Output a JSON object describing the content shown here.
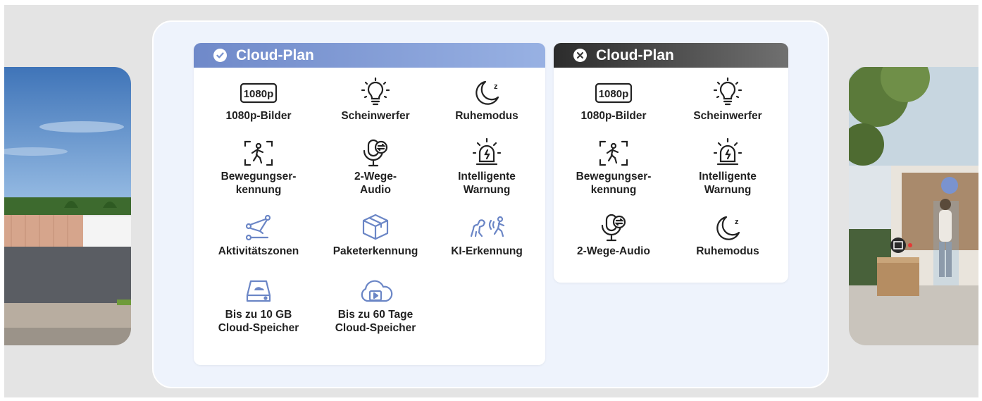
{
  "colors": {
    "background": "#e4e4e4",
    "panel": "#eef3fc",
    "premium_header": "#7a93cf",
    "basic_header": "#3a3a3a",
    "premium_feature_text": "#6b86c6",
    "feature_text": "#222222"
  },
  "premium": {
    "header_icon": "check-circle-icon",
    "title": "Cloud-Plan",
    "features": [
      {
        "label": "1080p-Bilder",
        "icon": "1080p-icon",
        "badge": "1080p"
      },
      {
        "label": "Scheinwerfer",
        "icon": "lightbulb-icon"
      },
      {
        "label": "Ruhemodus",
        "icon": "moon-icon",
        "badge": "z"
      },
      {
        "label": "Bewegungser-\nkennung",
        "icon": "motion-detection-icon"
      },
      {
        "label": "2-Wege-\nAudio",
        "icon": "microphone-icon"
      },
      {
        "label": "Intelligente\nWarnung",
        "icon": "alarm-siren-icon"
      },
      {
        "label": "Aktivitätszonen",
        "icon": "activity-zone-icon"
      },
      {
        "label": "Paketerkennung",
        "icon": "package-icon"
      },
      {
        "label": "KI-Erkennung",
        "icon": "ai-detection-icon"
      },
      {
        "label": "Bis zu 10 GB\nCloud-Speicher",
        "icon": "storage-icon"
      },
      {
        "label": "Bis zu 60 Tage\nCloud-Speicher",
        "icon": "cloud-video-icon"
      }
    ]
  },
  "basic": {
    "header_icon": "x-circle-icon",
    "title": "Cloud-Plan",
    "features": [
      {
        "label": "1080p-Bilder",
        "icon": "1080p-icon",
        "badge": "1080p"
      },
      {
        "label": "Scheinwerfer",
        "icon": "lightbulb-icon"
      },
      {
        "label": "Bewegungser-\nkennung",
        "icon": "motion-detection-icon"
      },
      {
        "label": "Intelligente\nWarnung",
        "icon": "alarm-siren-icon"
      },
      {
        "label": "2-Wege-Audio",
        "icon": "microphone-icon"
      },
      {
        "label": "Ruhemodus",
        "icon": "moon-icon",
        "badge": "z"
      }
    ]
  },
  "photos": {
    "left": "fence-gate-photo",
    "right": "house-person-package-photo"
  }
}
